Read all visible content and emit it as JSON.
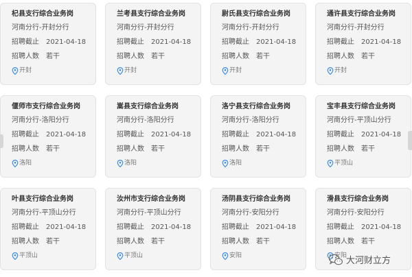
{
  "labels": {
    "deadline": "招聘截止",
    "headcount": "招聘人数"
  },
  "cards": [
    {
      "title": "杞县支行综合业务岗",
      "branch": "河南分行-开封分行",
      "deadline": "2021-04-18",
      "headcount": "若干",
      "location": "开封"
    },
    {
      "title": "兰考县支行综合业务岗",
      "branch": "河南分行-开封分行",
      "deadline": "2021-04-18",
      "headcount": "若干",
      "location": "开封"
    },
    {
      "title": "尉氏县支行综合业务岗",
      "branch": "河南分行-开封分行",
      "deadline": "2021-04-18",
      "headcount": "若干",
      "location": "开封"
    },
    {
      "title": "通许县支行综合业务岗",
      "branch": "河南分行-开封分行",
      "deadline": "2021-04-18",
      "headcount": "若干",
      "location": "开封"
    },
    {
      "title": "偃师市支行综合业务岗",
      "branch": "河南分行-洛阳分行",
      "deadline": "2021-04-18",
      "headcount": "若干",
      "location": "洛阳"
    },
    {
      "title": "嵩县支行综合业务岗",
      "branch": "河南分行-洛阳分行",
      "deadline": "2021-04-18",
      "headcount": "若干",
      "location": "洛阳"
    },
    {
      "title": "洛宁县支行综合业务岗",
      "branch": "河南分行-洛阳分行",
      "deadline": "2021-04-18",
      "headcount": "若干",
      "location": "洛阳"
    },
    {
      "title": "宝丰县支行综合业务岗",
      "branch": "河南分行-平顶山分行",
      "deadline": "2021-04-18",
      "headcount": "若干",
      "location": "平顶山"
    },
    {
      "title": "叶县支行综合业务岗",
      "branch": "河南分行-平顶山分行",
      "deadline": "2021-04-18",
      "headcount": "若干",
      "location": "平顶山"
    },
    {
      "title": "汝州市支行综合业务岗",
      "branch": "河南分行-平顶山分行",
      "deadline": "2021-04-18",
      "headcount": "若干",
      "location": "平顶山"
    },
    {
      "title": "汤阴县支行综合业务岗",
      "branch": "河南分行-安阳分行",
      "deadline": "2021-04-18",
      "headcount": "若干",
      "location": "安阳"
    },
    {
      "title": "滑县支行综合业务岗",
      "branch": "河南分行-安阳分行",
      "deadline": "2021-04-18",
      "headcount": "若干",
      "location": "安阳"
    }
  ],
  "watermark": {
    "text": "大河财立方",
    "icon": "wechat-icon"
  },
  "colors": {
    "card_bg": "#f4f4f4",
    "card_border": "#e2e2e2",
    "pin": "#3b8be0"
  }
}
